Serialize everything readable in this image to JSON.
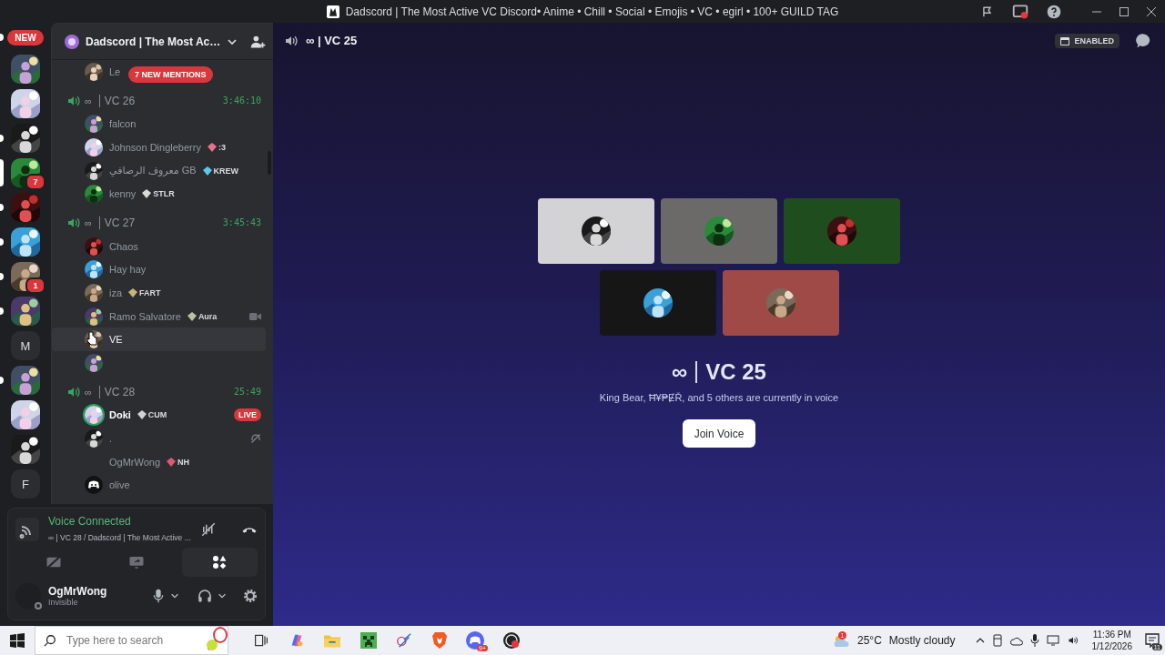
{
  "window": {
    "title": "Dadscord | The Most Active VC Discord• Anime • Chill • Social • Emojis • VC • egirl • 100+ GUILD TAG"
  },
  "servers": [
    {
      "kind": "pill",
      "label": "NEW",
      "unread": true,
      "selected": false
    },
    {
      "kind": "picture",
      "unread": false,
      "selected": false
    },
    {
      "kind": "picture",
      "unread": false,
      "selected": false
    },
    {
      "kind": "picture",
      "unread": true,
      "selected": false
    },
    {
      "kind": "picture",
      "unread": false,
      "selected": true,
      "badge": "7"
    },
    {
      "kind": "picture",
      "unread": true,
      "selected": false
    },
    {
      "kind": "picture",
      "unread": true,
      "selected": false
    },
    {
      "kind": "picture",
      "unread": true,
      "selected": false,
      "badge": "1"
    },
    {
      "kind": "picture",
      "unread": true,
      "selected": false
    },
    {
      "kind": "letter",
      "label": "M",
      "unread": false,
      "selected": false
    },
    {
      "kind": "picture",
      "unread": true,
      "selected": false
    },
    {
      "kind": "picture",
      "unread": false,
      "selected": false
    },
    {
      "kind": "picture",
      "unread": false,
      "selected": false
    },
    {
      "kind": "letter",
      "label": "F",
      "unread": false,
      "selected": false
    }
  ],
  "server": {
    "name": "Dadscord | The Most Ac…",
    "mentions": "7 NEW MENTIONS",
    "top_member": "Le"
  },
  "channels": [
    {
      "prefix": "∞",
      "name": "VC 26",
      "timer": "3:46:10",
      "members": [
        {
          "kind": "avatar",
          "name": "falcon",
          "speaking": false,
          "highlighted": false,
          "camera": false,
          "deafened": false
        },
        {
          "kind": "avatar",
          "name": "Johnson Dingleberry",
          "tag": {
            "text": ":3",
            "color": "#e8718d"
          },
          "speaking": false,
          "highlighted": false,
          "camera": false,
          "deafened": false
        },
        {
          "kind": "avatar",
          "name": "معروف الرصافي GB",
          "tag": {
            "text": "KREW",
            "color": "#5ec8e8"
          },
          "speaking": false,
          "highlighted": false,
          "camera": false,
          "deafened": false
        },
        {
          "kind": "avatar",
          "name": "kenny",
          "tag": {
            "text": "STLR",
            "color": "#d9d9d9"
          },
          "speaking": false,
          "highlighted": false,
          "camera": false,
          "deafened": false
        }
      ]
    },
    {
      "prefix": "∞",
      "name": "VC 27",
      "timer": "3:45:43",
      "members": [
        {
          "kind": "avatar",
          "name": "Chaos",
          "speaking": false,
          "highlighted": false,
          "camera": false,
          "deafened": false
        },
        {
          "kind": "avatar",
          "name": "Hay hay",
          "speaking": false,
          "highlighted": false,
          "camera": false,
          "deafened": false
        },
        {
          "kind": "avatar",
          "name": "iza",
          "tag": {
            "text": "FART",
            "color": "#c9b37a"
          },
          "speaking": false,
          "highlighted": false,
          "camera": false,
          "deafened": false
        },
        {
          "kind": "avatar",
          "name": "Ramo Salvatore",
          "tag": {
            "text": "Aura",
            "color": "#b8c4a0"
          },
          "speaking": false,
          "highlighted": false,
          "camera": true,
          "deafened": false
        },
        {
          "kind": "avatar",
          "name": "VE",
          "speaking": false,
          "highlighted": true,
          "camera": false,
          "deafened": false
        },
        {
          "kind": "avatar",
          "speaking": false,
          "highlighted": false,
          "camera": false,
          "deafened": false
        }
      ]
    },
    {
      "prefix": "∞",
      "name": "VC 28",
      "timer": "25:49",
      "members": [
        {
          "kind": "avatar",
          "name": "Doki",
          "tag": {
            "text": "CUM",
            "color": "#cfd3d8"
          },
          "live": "LIVE",
          "speaking": true,
          "highlighted": false,
          "camera": false,
          "deafened": false
        },
        {
          "kind": "avatar",
          "name": ".",
          "speaking": false,
          "highlighted": false,
          "camera": false,
          "deafened": true
        },
        {
          "kind": "blank",
          "name": "OgMrWong",
          "tag": {
            "text": "NH",
            "color": "#e0576f"
          },
          "speaking": false,
          "highlighted": false,
          "camera": false,
          "deafened": false
        },
        {
          "kind": "logo",
          "name": "olive",
          "speaking": false,
          "highlighted": false,
          "camera": false,
          "deafened": false
        }
      ]
    }
  ],
  "voice": {
    "status": "Voice Connected",
    "detail": "∞ | VC 28 / Dadscord | The Most Active ..."
  },
  "user": {
    "name": "OgMrWong",
    "status": "Invisible"
  },
  "stage": {
    "channel": "∞ | VC 25",
    "chip": "ENABLED",
    "tiles": [
      {
        "color": "#d3d3d6"
      },
      {
        "color": "#6b6a68"
      },
      {
        "color": "#1f4d1e"
      },
      {
        "color": "#161616"
      },
      {
        "color": "#a04a48"
      }
    ],
    "title_prefix": "∞",
    "title": "VC 25",
    "subtitle": "King Bear, Ħ¥₱ɆŘ, and 5 others are currently in voice",
    "join": "Join Voice"
  },
  "taskbar": {
    "search_placeholder": "Type here to search",
    "apps": [
      {
        "kind": "taskview"
      },
      {
        "kind": "copilot"
      },
      {
        "kind": "folder"
      },
      {
        "kind": "creeper"
      },
      {
        "kind": "snip"
      },
      {
        "kind": "brave"
      },
      {
        "kind": "discord",
        "badge": "9+"
      },
      {
        "kind": "obs"
      }
    ],
    "weather": {
      "badge": "1",
      "temp": "25°C",
      "condition": "Mostly cloudy"
    },
    "time": "11:36 PM",
    "date": "1/12/2026",
    "notifications": "11"
  }
}
